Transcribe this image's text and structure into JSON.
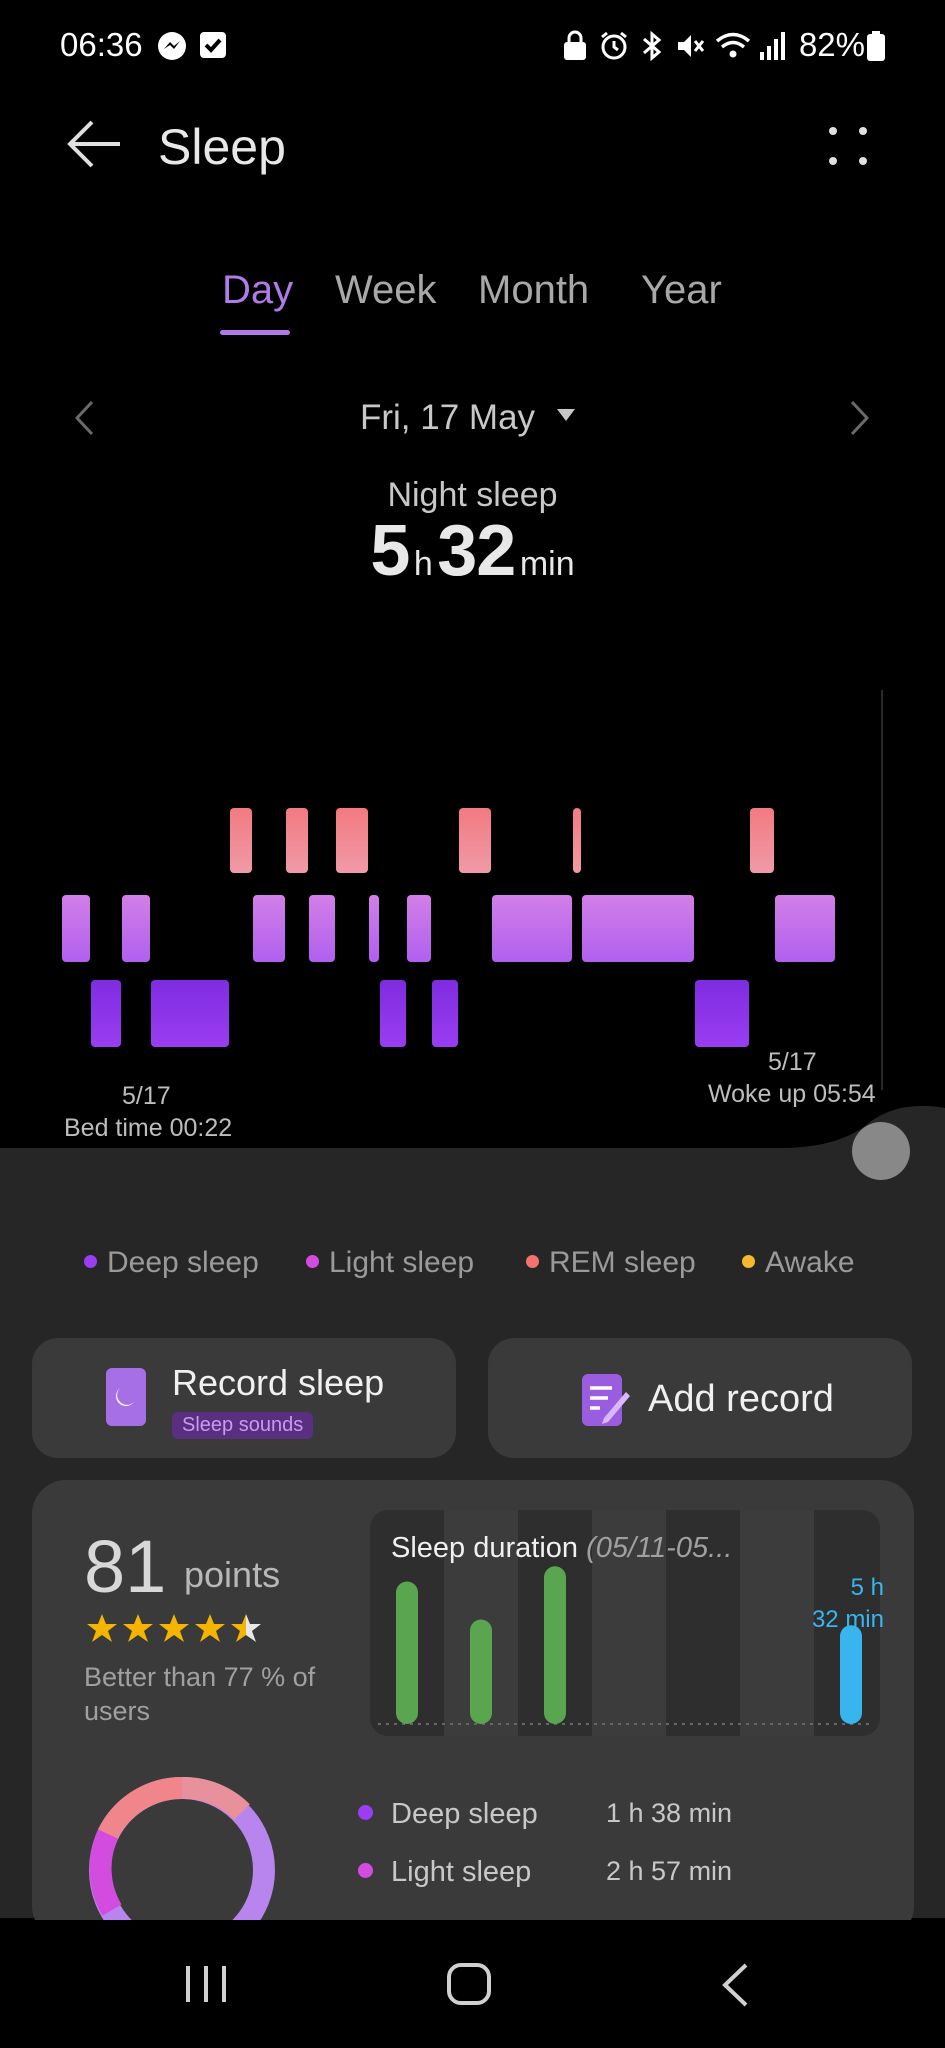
{
  "status_bar": {
    "time": "06:36",
    "battery": "82%",
    "left_icons": [
      "messenger-icon",
      "check-icon"
    ],
    "right_icons": [
      "lock-icon",
      "alarm-icon",
      "bluetooth-icon",
      "mute-icon",
      "wifi-icon",
      "signal-icon",
      "battery-icon"
    ]
  },
  "header": {
    "title": "Sleep"
  },
  "tabs": [
    {
      "label": "Day",
      "active": true
    },
    {
      "label": "Week",
      "active": false
    },
    {
      "label": "Month",
      "active": false
    },
    {
      "label": "Year",
      "active": false
    }
  ],
  "date_nav": {
    "label": "Fri, 17 May"
  },
  "summary": {
    "label": "Night sleep",
    "hours": "5",
    "hours_unit": "h",
    "minutes": "32",
    "minutes_unit": "min"
  },
  "chart": {
    "bed_date": "5/17",
    "bed_time": "Bed time 00:22",
    "wake_date": "5/17",
    "wake_time": "Woke up 05:54",
    "stages_sequence": [
      "light",
      "deep",
      "light",
      "deep",
      "rem",
      "light",
      "rem",
      "light",
      "rem",
      "light",
      "deep",
      "light",
      "deep",
      "rem",
      "light",
      "rem",
      "light",
      "deep",
      "rem",
      "light"
    ]
  },
  "legend": [
    {
      "label": "Deep sleep",
      "color": "#9b3df0"
    },
    {
      "label": "Light sleep",
      "color": "#d24ce0"
    },
    {
      "label": "REM sleep",
      "color": "#f5736f"
    },
    {
      "label": "Awake",
      "color": "#f5b82e"
    }
  ],
  "actions": {
    "record_sleep": "Record sleep",
    "sleep_sounds": "Sleep sounds",
    "add_record": "Add record"
  },
  "score": {
    "value": "81",
    "unit": "points",
    "rating": 4.5,
    "compare": "Better than 77 % of users"
  },
  "duration_card": {
    "title": "Sleep duration",
    "range": "(05/11-05...",
    "value_line1": "5 h",
    "value_line2": "32 min",
    "bars": [
      0.75,
      0.55,
      0.83,
      0,
      0,
      0,
      0.52
    ],
    "colors": {
      "past": "#5aa54f",
      "today": "#38b5ef"
    }
  },
  "stages": [
    {
      "label": "Deep sleep",
      "value": "1 h 38 min",
      "color": "#9b3df0"
    },
    {
      "label": "Light sleep",
      "value": "2 h 57 min",
      "color": "#d24ce0"
    }
  ],
  "colors": {
    "accent": "#b07be8",
    "deep": "#8a2df0",
    "light": "#c06ee8",
    "rem": "#f07e88"
  }
}
